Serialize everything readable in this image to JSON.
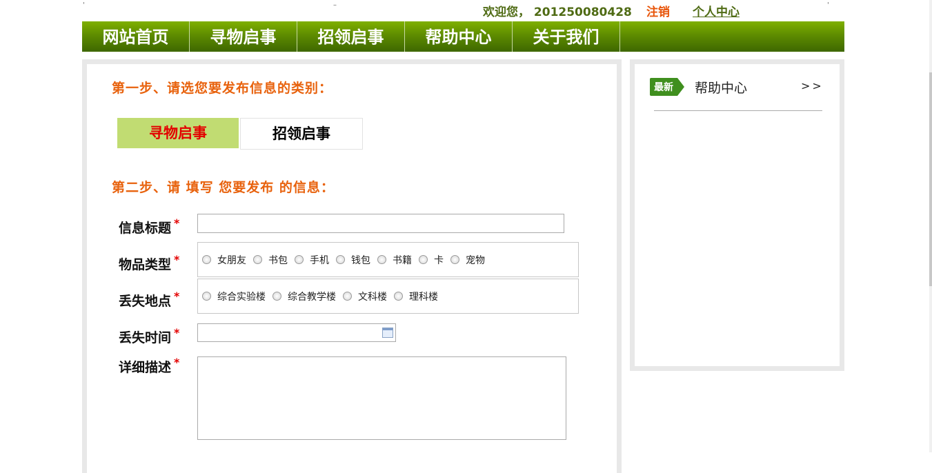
{
  "header": {
    "welcome": "欢迎您， 201250080428",
    "logout": "注销",
    "profile": "个人中心"
  },
  "nav": {
    "items": [
      "网站首页",
      "寻物启事",
      "招领启事",
      "帮助中心",
      "关于我们"
    ]
  },
  "form": {
    "step1": "第一步、请选您要发布信息的类别：",
    "tabs": {
      "active": "寻物启事",
      "other": "招领启事"
    },
    "step2": "第二步、请 填写 您要发布 的信息：",
    "required_mark": "*",
    "title_label": "信息标题",
    "title_value": "",
    "type_label": "物品类型",
    "types": [
      "女朋友",
      "书包",
      "手机",
      "钱包",
      "书籍",
      "卡",
      "宠物"
    ],
    "place_label": "丢失地点",
    "places": [
      "综合实验楼",
      "综合教学楼",
      "文科楼",
      "理科楼"
    ],
    "time_label": "丢失时间",
    "time_value": "",
    "desc_label": "详细描述",
    "desc_value": ""
  },
  "sidebar": {
    "badge": "最新",
    "title": "帮助中心",
    "more": ">>"
  },
  "colors": {
    "nav_green": "#5e8c00",
    "accent_orange": "#e8620d",
    "active_tab": "#c1dc72",
    "required_red": "#e30000"
  }
}
